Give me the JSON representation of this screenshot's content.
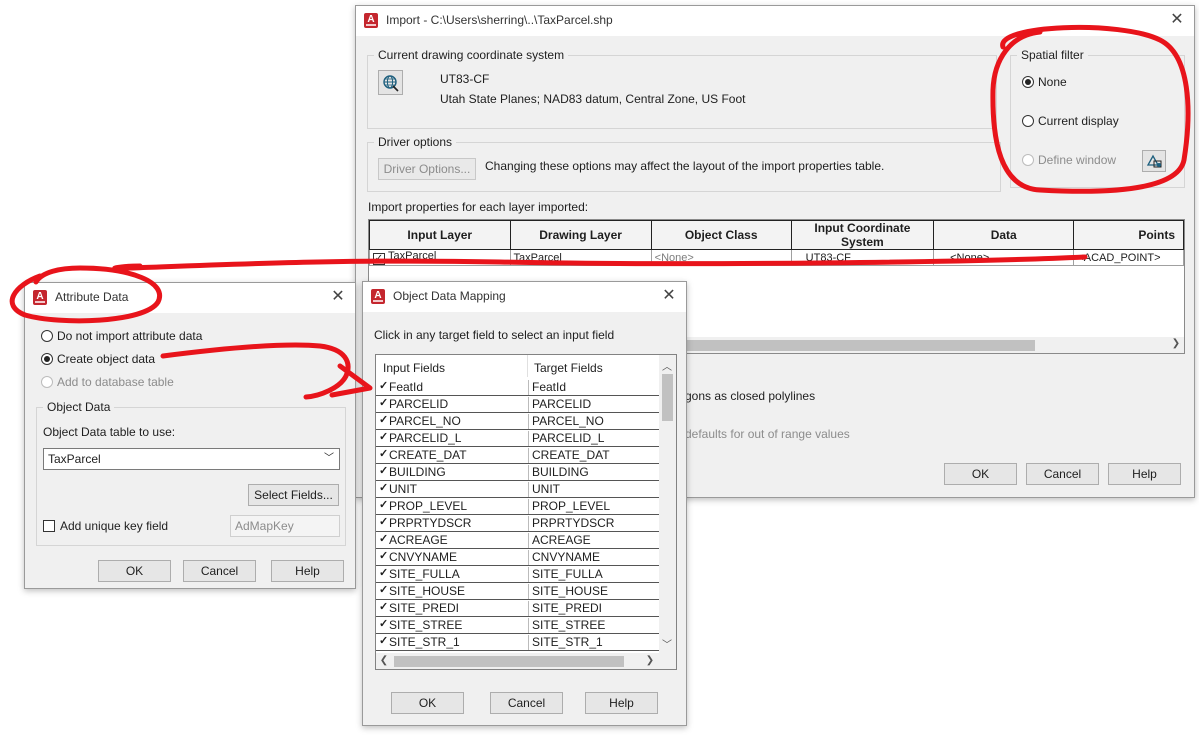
{
  "import_dialog": {
    "title": "Import - C:\\Users\\sherring\\..\\TaxParcel.shp",
    "coord_group_label": "Current drawing coordinate system",
    "coord_code": "UT83-CF",
    "coord_description": "Utah State Planes; NAD83 datum, Central Zone, US Foot",
    "driver_group_label": "Driver options",
    "driver_button": "Driver Options...",
    "driver_note": "Changing these options may affect the layout of the import properties table.",
    "spatial_group_label": "Spatial filter",
    "spatial_options": [
      "None",
      "Current display",
      "Define window"
    ],
    "layer_section_label": "Import properties for each layer imported:",
    "table_headers": [
      "Input Layer",
      "Drawing Layer",
      "Object Class",
      "Input Coordinate System",
      "Data",
      "Points"
    ],
    "table_row": [
      "TaxParcel",
      "TaxParcel",
      "<None>",
      "UT83-CF",
      "<None>",
      "<ACAD_POINT>"
    ],
    "option_closed_polylines": "gons as closed polylines",
    "option_defaults": "defaults for out of range values",
    "ok": "OK",
    "cancel": "Cancel",
    "help": "Help"
  },
  "attribute_dialog": {
    "title": "Attribute Data",
    "options": [
      "Do not import attribute data",
      "Create object data",
      "Add to database table"
    ],
    "object_data_group_label": "Object Data",
    "table_to_use_label": "Object Data table to use:",
    "table_value": "TaxParcel",
    "select_fields_button": "Select Fields...",
    "unique_key_label": "Add unique key field",
    "unique_key_value": "AdMapKey",
    "ok": "OK",
    "cancel": "Cancel",
    "help": "Help"
  },
  "mapping_dialog": {
    "title": "Object Data Mapping",
    "instruction": "Click in any target field to select an input field",
    "col_input": "Input Fields",
    "col_target": "Target Fields",
    "rows": [
      [
        "FeatId",
        "FeatId"
      ],
      [
        "PARCELID",
        "PARCELID"
      ],
      [
        "PARCEL_NO",
        "PARCEL_NO"
      ],
      [
        "PARCELID_L",
        "PARCELID_L"
      ],
      [
        "CREATE_DAT",
        "CREATE_DAT"
      ],
      [
        "BUILDING",
        "BUILDING"
      ],
      [
        "UNIT",
        "UNIT"
      ],
      [
        "PROP_LEVEL",
        "PROP_LEVEL"
      ],
      [
        "PRPRTYDSCR",
        "PRPRTYDSCR"
      ],
      [
        "ACREAGE",
        "ACREAGE"
      ],
      [
        "CNVYNAME",
        "CNVYNAME"
      ],
      [
        "SITE_FULLA",
        "SITE_FULLA"
      ],
      [
        "SITE_HOUSE",
        "SITE_HOUSE"
      ],
      [
        "SITE_PREDI",
        "SITE_PREDI"
      ],
      [
        "SITE_STREE",
        "SITE_STREE"
      ],
      [
        "SITE_STR_1",
        "SITE_STR_1"
      ]
    ],
    "ok": "OK",
    "cancel": "Cancel",
    "help": "Help"
  },
  "colors": {
    "annotation_red": "#e8141b",
    "app_logo": "#c4262e"
  }
}
